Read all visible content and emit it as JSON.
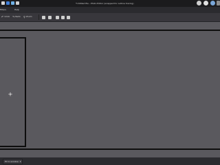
{
  "window": {
    "title": "*Untitled file - Photo Editor (wrapped for outline tracing)"
  },
  "menubar": {
    "items": [
      "Filters",
      "Help"
    ]
  },
  "toolbar": {
    "buttons": [
      "Undo",
      "Redo",
      "Zoom"
    ]
  },
  "status": {
    "zoom_select": "Fit to window"
  },
  "colors": {
    "workspace": "#5a595e",
    "bars": "#2b2b2f"
  }
}
